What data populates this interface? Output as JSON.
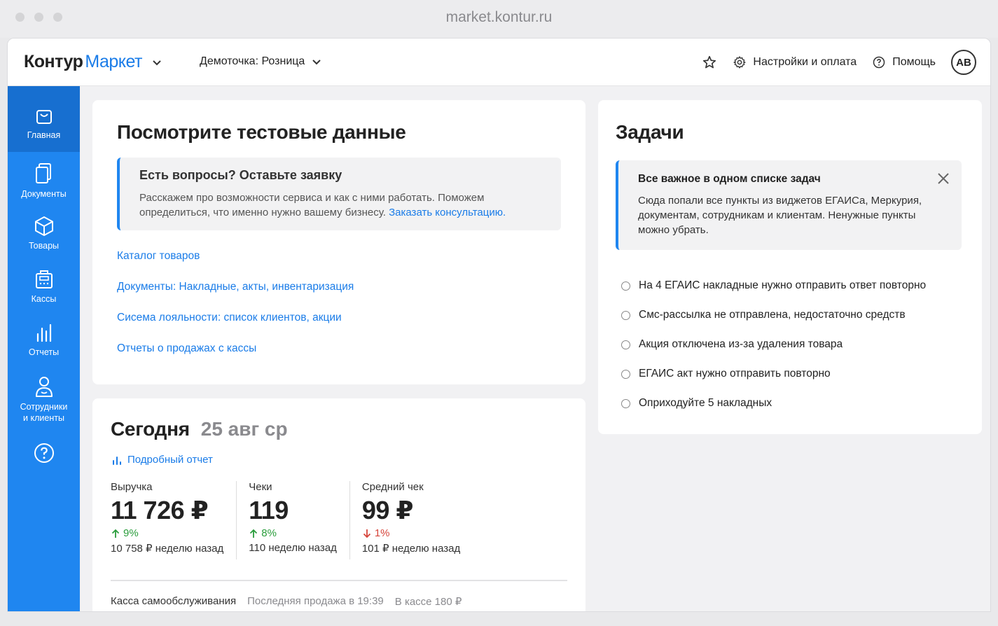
{
  "browser": {
    "url": "market.kontur.ru"
  },
  "topbar": {
    "logo_part1": "Контур",
    "logo_part2": "Маркет",
    "org_name": "Демоточка: Розница",
    "settings_label": "Настройки и оплата",
    "help_label": "Помощь",
    "avatar_initials": "АВ"
  },
  "sidebar": {
    "items": [
      {
        "label": "Главная",
        "icon": "bag-icon"
      },
      {
        "label": "Документы",
        "icon": "documents-icon"
      },
      {
        "label": "Товары",
        "icon": "box-icon"
      },
      {
        "label": "Кассы",
        "icon": "cash-register-icon"
      },
      {
        "label": "Отчеты",
        "icon": "bar-chart-icon"
      },
      {
        "label_line1": "Сотрудники",
        "label_line2": "и клиенты",
        "icon": "person-icon"
      },
      {
        "icon": "help-icon"
      }
    ]
  },
  "test_data_card": {
    "title": "Посмотрите тестовые данные",
    "notice_title": "Есть вопросы? Оставьте заявку",
    "notice_body": "Расскажем про возможности сервиса и как с ними работать. Поможем определиться, что именно нужно вашему бизнесу.",
    "notice_link": "Заказать консультацию.",
    "links": [
      "Каталог товаров",
      "Документы: Накладные, акты, инвентаризация",
      "Сисема лояльности: список клиентов, акции",
      "Отчеты о продажах с кассы"
    ]
  },
  "today_card": {
    "title": "Сегодня",
    "date": "25 авг ср",
    "report_link": "Подробный отчет",
    "metrics": [
      {
        "label": "Выручка",
        "value": "11 726 ₽",
        "delta": "9%",
        "direction": "up",
        "prev": "10 758 ₽ неделю назад"
      },
      {
        "label": "Чеки",
        "value": "119",
        "delta": "8%",
        "direction": "up",
        "prev": "110 неделю назад"
      },
      {
        "label": "Средний чек",
        "value": "99 ₽",
        "delta": "1%",
        "direction": "down",
        "prev": "101 ₽ неделю назад"
      }
    ],
    "kassa_name": "Касса самообслуживания",
    "kassa_last_sale": "Последняя продажа в 19:39",
    "kassa_balance": "В кассе 180 ₽"
  },
  "tasks_card": {
    "title": "Задачи",
    "notice_title": "Все важное в одном списке задач",
    "notice_body": "Сюда попали все пункты из виджетов ЕГАИСа, Меркурия, документам, сотрудникам и клиентам. Ненужные пункты можно убрать.",
    "tasks": [
      "На 4 ЕГАИС накладные нужно отправить ответ повторно",
      "Смс-рассылка не отправлена, недостаточно средств",
      "Акция отключена из-за удаления товара",
      "ЕГАИС акт нужно отправить повторно",
      "Оприходуйте 5 накладных"
    ]
  },
  "colors": {
    "brand": "#1f86f0",
    "link": "#1a7ce8",
    "up": "#2a9d3c",
    "down": "#d6453b"
  }
}
